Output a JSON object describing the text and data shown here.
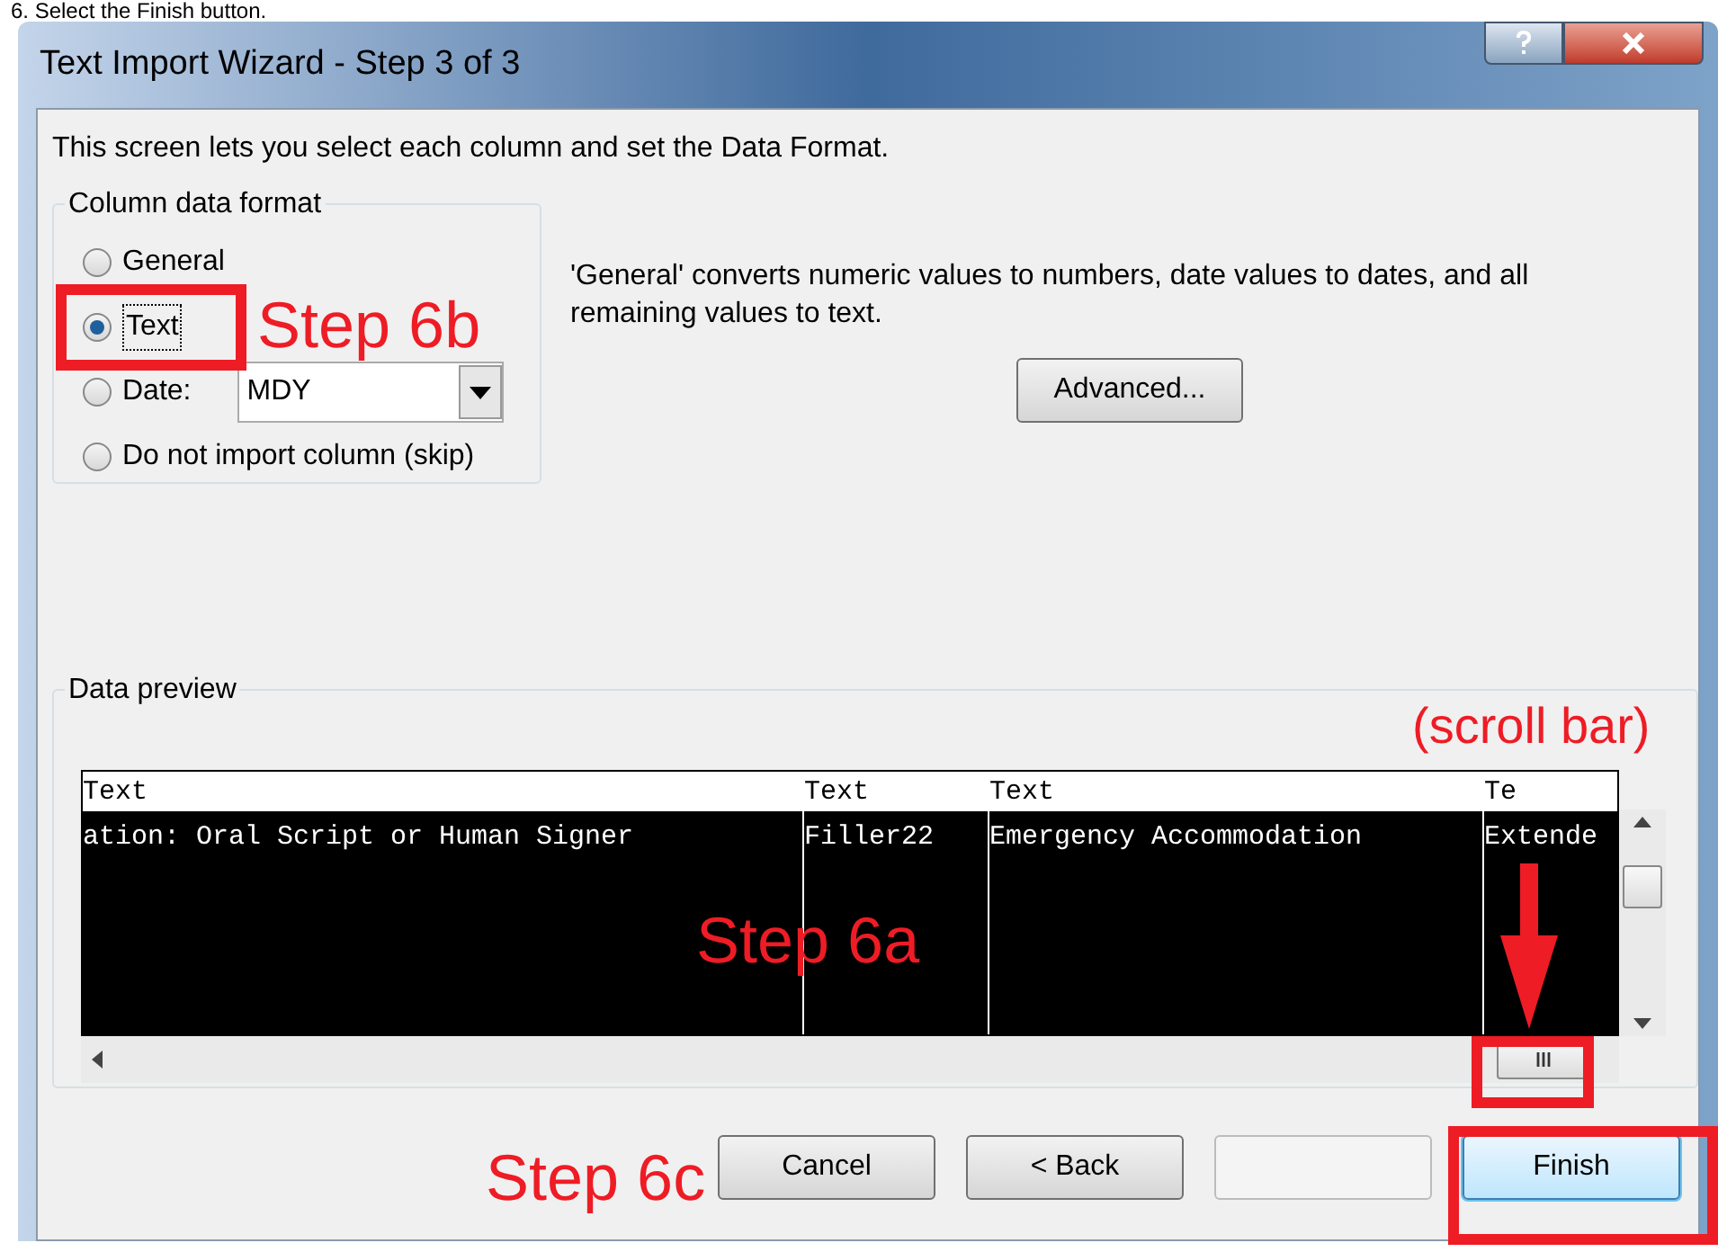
{
  "caption": "6.   Select the Finish button.",
  "window": {
    "title": "Text Import Wizard - Step 3 of 3"
  },
  "intro": "This screen lets you select each column and set the Data Format.",
  "format_group": {
    "legend": "Column data format",
    "options": [
      {
        "kind": "plain",
        "label": "General",
        "selected": false
      },
      {
        "kind": "plain",
        "label": "Text",
        "selected": true
      },
      {
        "kind": "date",
        "label": "Date:",
        "selected": false,
        "value": "MDY"
      },
      {
        "kind": "plain",
        "label": "Do not import column (skip)",
        "selected": false
      }
    ]
  },
  "description": "'General' converts numeric values to numbers, date values to dates, and all remaining values to text.",
  "advanced_button": "Advanced...",
  "preview": {
    "legend": "Data preview",
    "columns": [
      {
        "header": "Text",
        "cell": "ation: Oral Script or Human Signer"
      },
      {
        "header": "Text",
        "cell": "Filler22"
      },
      {
        "header": "Text",
        "cell": "Emergency Accommodation"
      },
      {
        "header": "Te",
        "cell": "Extende"
      }
    ]
  },
  "buttons": [
    {
      "label": "Cancel",
      "disabled": false,
      "default": false
    },
    {
      "label": "< Back",
      "disabled": false,
      "default": false
    },
    {
      "disabled": true,
      "default": false
    },
    {
      "label": "Finish",
      "disabled": false,
      "default": true
    }
  ],
  "annotations": [
    "Step 6b",
    "Step 6a",
    "(scroll bar)",
    "Step 6c"
  ]
}
